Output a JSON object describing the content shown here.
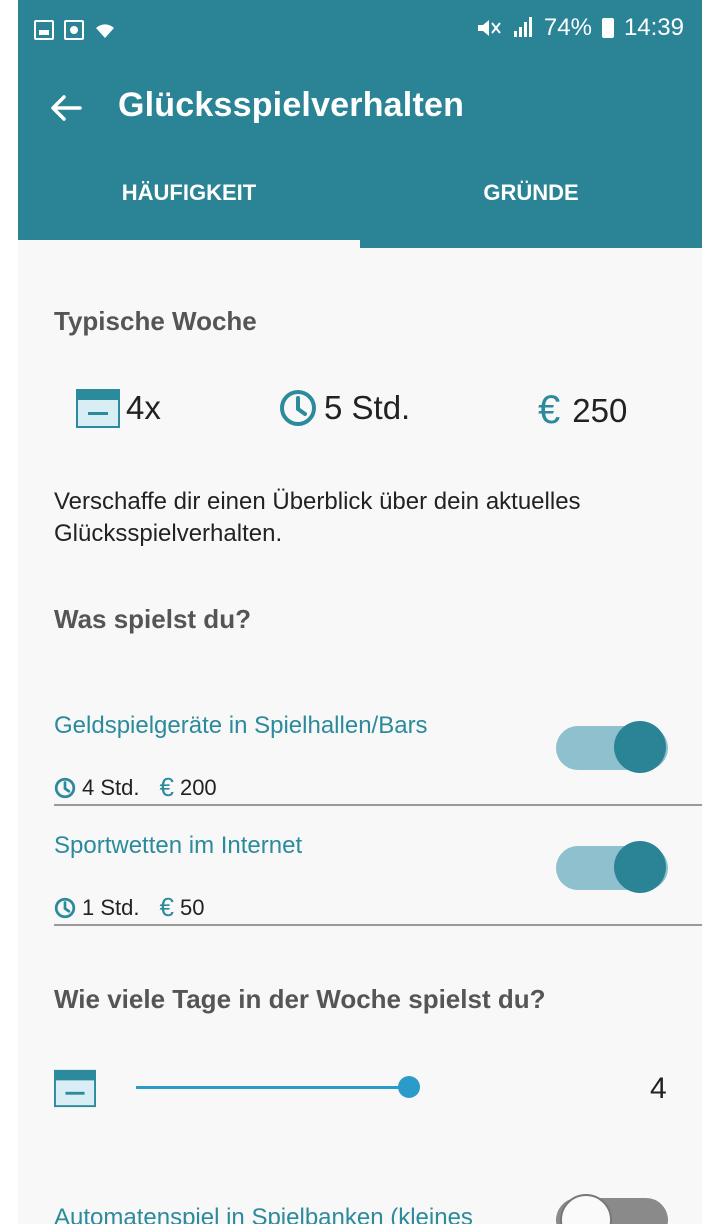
{
  "status_bar": {
    "battery": "74%",
    "time": "14:39"
  },
  "app_bar": {
    "title": "Glücksspielverhalten"
  },
  "tabs": [
    {
      "label": "HÄUFIGKEIT"
    },
    {
      "label": "GRÜNDE"
    }
  ],
  "typical_week": {
    "title": "Typische Woche",
    "frequency": "4x",
    "duration": "5 Std.",
    "amount": "250"
  },
  "description": "Verschaffe dir einen Überblick über dein aktuelles Glücksspielverhalten.",
  "games_section": {
    "title": "Was spielst du?"
  },
  "games": [
    {
      "title": "Geldspielgeräte in Spielhallen/Bars",
      "hours": "4 Std.",
      "amount": "200",
      "enabled": true
    },
    {
      "title": "Sportwetten im Internet",
      "hours": "1 Std.",
      "amount": "50",
      "enabled": true
    }
  ],
  "days_section": {
    "title": "Wie viele Tage in der Woche spielst du?",
    "value": "4"
  },
  "next_game": {
    "title": "Automatenspiel in Spielbanken (kleines",
    "enabled": false
  },
  "colors": {
    "primary": "#2b8496",
    "accent": "#2b8a9c",
    "slider": "#2b9bc9"
  },
  "icons": [
    "back-arrow-icon",
    "calendar-icon",
    "clock-icon",
    "euro-icon",
    "wifi-icon",
    "battery-icon"
  ]
}
